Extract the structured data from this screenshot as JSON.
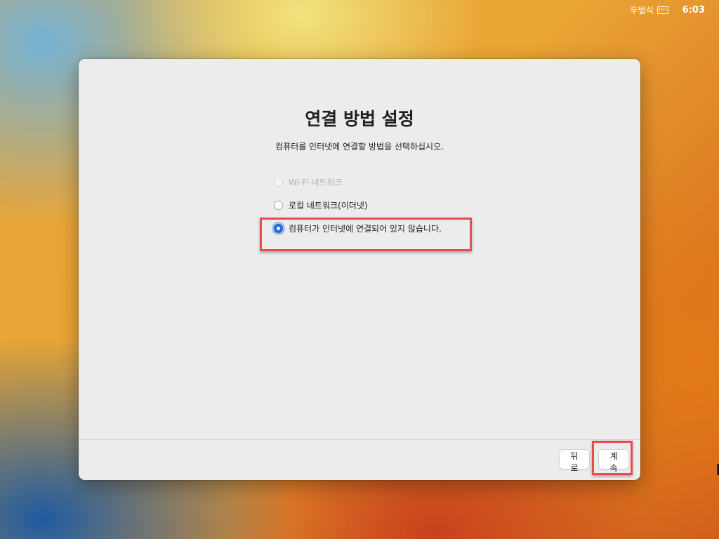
{
  "menubar": {
    "input_source_label": "두벌식",
    "input_source_icon": "keyboard-icon",
    "clock": "6:03"
  },
  "window": {
    "title": "연결 방법 설정",
    "subtitle": "컴퓨터를 인터넷에 연결할 방법을 선택하십시오.",
    "options": [
      {
        "label": "Wi-Fi 네트워크",
        "enabled": false,
        "selected": false
      },
      {
        "label": "로컬 네트워크(이더넷)",
        "enabled": true,
        "selected": false
      },
      {
        "label": "컴퓨터가 인터넷에 연결되어 있지 않습니다.",
        "enabled": true,
        "selected": true
      }
    ],
    "buttons": {
      "back": "뒤로",
      "continue": "계속"
    }
  },
  "colors": {
    "accent": "#1f6fe5",
    "highlight_box": "#e54e4e",
    "panel_background": "#ececec"
  }
}
